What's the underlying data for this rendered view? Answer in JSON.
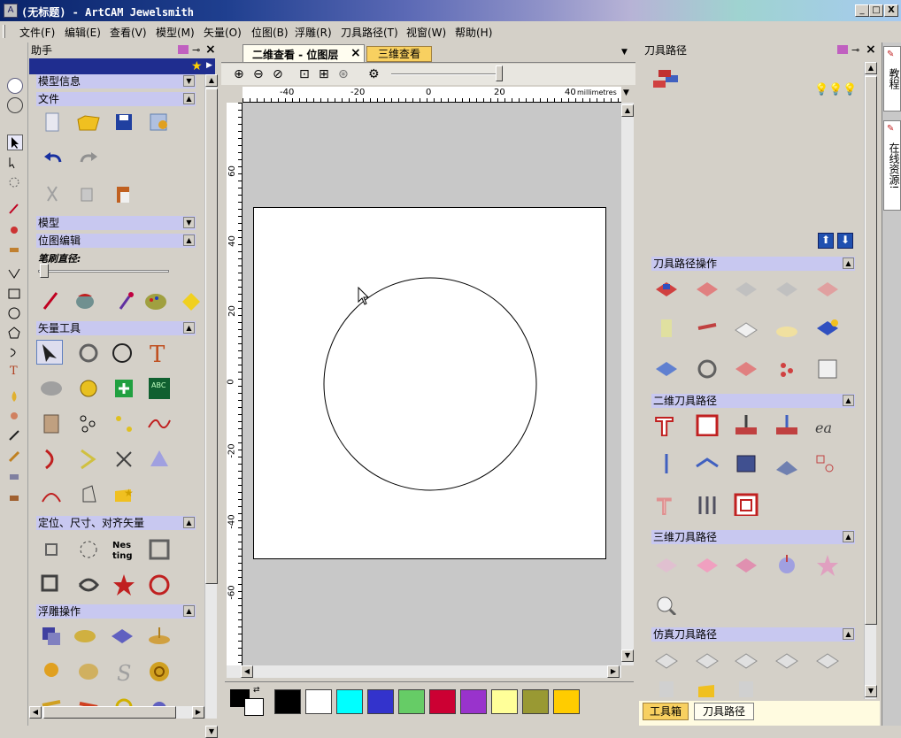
{
  "window": {
    "title": "(无标题) - ArtCAM Jewelsmith",
    "min": "_",
    "max": "□",
    "close": "X"
  },
  "menu": [
    "文件(F)",
    "编辑(E)",
    "查看(V)",
    "模型(M)",
    "矢量(O)",
    "位图(B)",
    "浮雕(R)",
    "刀具路径(T)",
    "视窗(W)",
    "帮助(H)"
  ],
  "assistant": {
    "title": "助手",
    "sections": {
      "model_info": "模型信息",
      "file": "文件",
      "model": "模型",
      "bitmap_edit": "位图编辑",
      "brush_label": "笔刷直径:",
      "vector_tools": "矢量工具",
      "align": "定位、尺寸、对齐矢量",
      "relief_ops": "浮雕操作"
    }
  },
  "tabs": {
    "tab2d": "二维查看 - 位图层",
    "tab3d": "三维查看",
    "close": "×"
  },
  "ruler": {
    "h_ticks": [
      "-40",
      "-20",
      "0",
      "20",
      "40"
    ],
    "h_unit": "millimetres",
    "v_ticks": [
      "60",
      "40",
      "20",
      "0",
      "-20",
      "-40",
      "-60"
    ]
  },
  "palette": {
    "colors": [
      "#000000",
      "#ffffff",
      "#00ffff",
      "#3333cc",
      "#66cc66",
      "#cc0033",
      "#9933cc",
      "#ffff99",
      "#999933",
      "#ffcc00"
    ]
  },
  "toolpath": {
    "title": "刀具路径",
    "sections": {
      "ops": "刀具路径操作",
      "twoD": "二维刀具路径",
      "threeD": "三维刀具路径",
      "sim": "仿真刀具路径"
    },
    "bottom_tabs": [
      "工具箱",
      "刀具路径"
    ]
  },
  "side_tabs": [
    "教程",
    "在线资源!"
  ]
}
